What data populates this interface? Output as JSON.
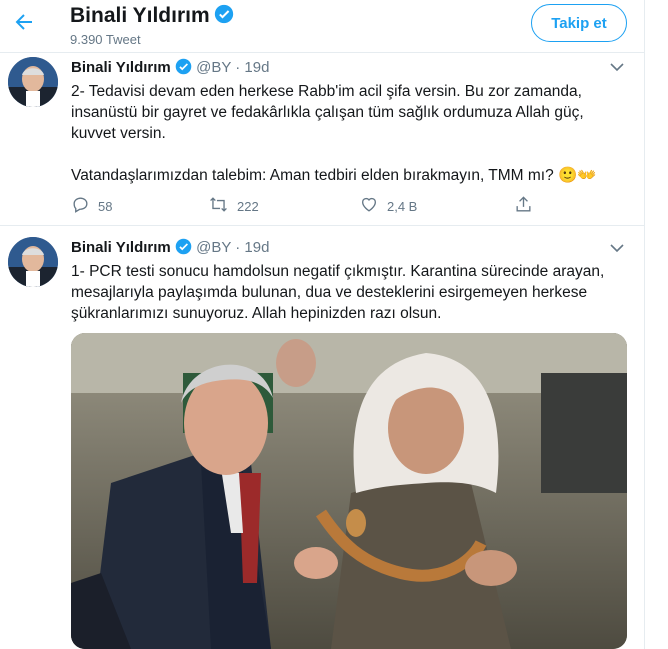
{
  "header": {
    "back_icon": "arrow-left-icon",
    "name": "Binali Yıldırım",
    "tweet_count": "9.390 Tweet",
    "follow_label": "Takip et"
  },
  "tweets": [
    {
      "name": "Binali Yıldırım",
      "handle": "@BY",
      "sep": "·",
      "time": "19d",
      "text_1": "2- Tedavisi devam eden herkese Rabb'im acil şifa versin. Bu zor zamanda, insanüstü bir gayret ve fedakârlıkla çalışan tüm sağlık ordumuza Allah güç, kuvvet versin.",
      "text_2": "Vatandaşlarımızdan talebim: Aman tedbiri elden bırakmayın, TMM mı? 🙂👐",
      "replies": "58",
      "retweets": "222",
      "likes": "2,4 B"
    },
    {
      "name": "Binali Yıldırım",
      "handle": "@BY",
      "sep": "·",
      "time": "19d",
      "text_1": "1- PCR testi sonucu hamdolsun negatif çıkmıştır. Karantina sürecinde arayan, mesajlarıyla paylaşımda bulunan, dua ve desteklerini esirgemeyen herkese şükranlarımızı sunuyoruz. Allah hepinizden razı olsun."
    }
  ],
  "colors": {
    "accent": "#1da1f2",
    "text": "#14171a",
    "secondary": "#657786",
    "border": "#e6ecf0"
  }
}
